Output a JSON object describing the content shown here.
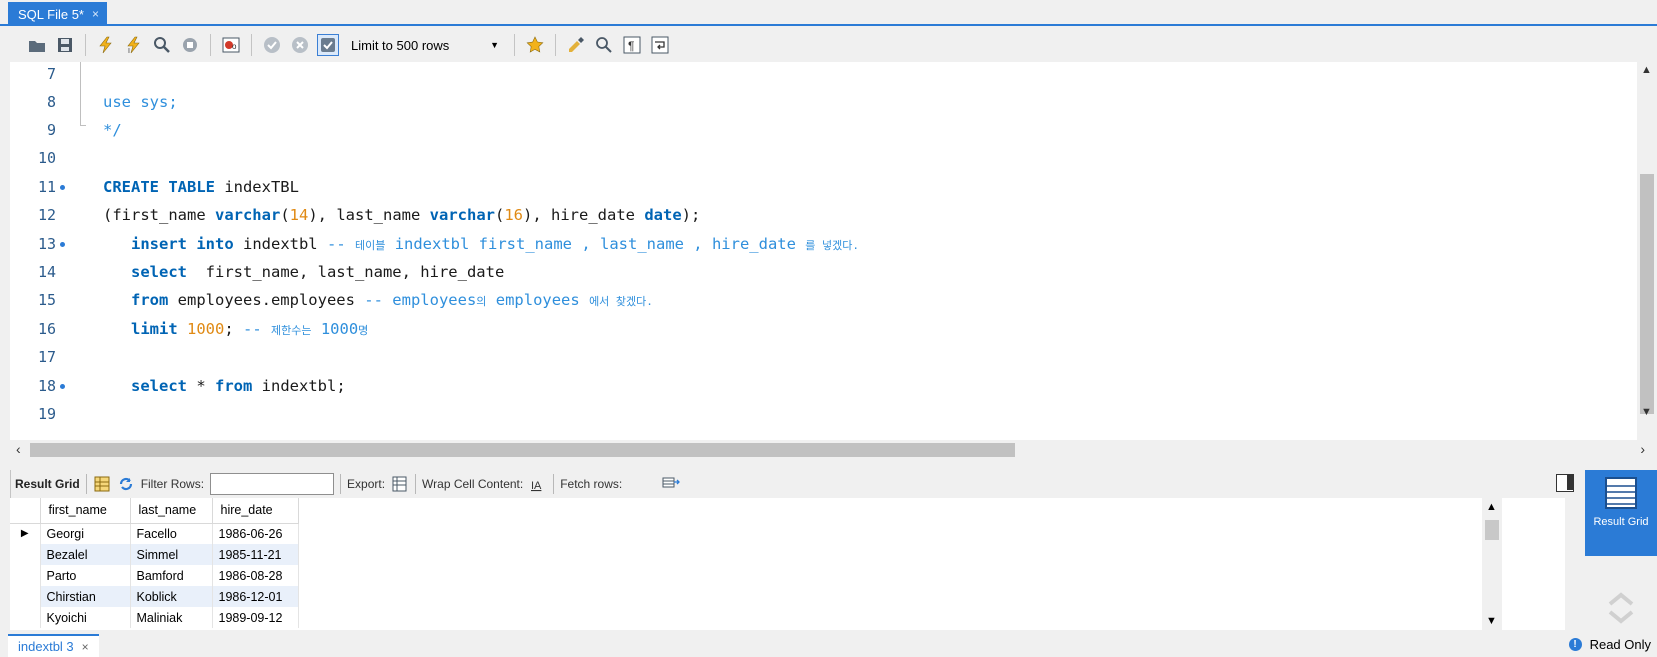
{
  "document_tab": {
    "title": "SQL File 5*",
    "close": "×"
  },
  "toolbar": {
    "limit_select": "Limit to 500 rows",
    "icons": [
      "open-file-icon",
      "save-icon",
      "execute-icon",
      "execute-current-icon",
      "explain-icon",
      "stop-icon",
      "toggle-error-icon",
      "commit-icon",
      "rollback-icon",
      "autocommit-icon",
      "bookmark-icon",
      "beautify-icon",
      "find-icon",
      "invisible-chars-icon",
      "wrap-icon"
    ]
  },
  "editor": {
    "lines": [
      {
        "n": "7"
      },
      {
        "n": "8",
        "t1": "use sys;"
      },
      {
        "n": "9",
        "t1": "*/"
      },
      {
        "n": "10"
      },
      {
        "n": "11",
        "k1": "CREATE TABLE",
        "t1": " indexTBL"
      },
      {
        "n": "12",
        "t1": "(first_name ",
        "k1": "varchar",
        "t2": "(",
        "num1": "14",
        "t3": "), last_name ",
        "k2": "varchar",
        "t4": "(",
        "num2": "16",
        "t5": "), hire_date ",
        "k3": "date",
        "t6": ");"
      },
      {
        "n": "13",
        "k1": "insert into",
        "t1": " indextbl ",
        "c1": "-- ",
        "c2": "테이블",
        "c3": " indextbl first_name , last_name , hire_date ",
        "c4": "를 넣겠다."
      },
      {
        "n": "14",
        "k1": "select",
        "t1": "  first_name, last_name, hire_date"
      },
      {
        "n": "15",
        "k1": "from",
        "t1": " employees.employees ",
        "c1": "-- employees",
        "c2": "의",
        "c3": " employees ",
        "c4": "에서 찾겠다."
      },
      {
        "n": "16",
        "k1": "limit",
        "t1": " ",
        "num1": "1000",
        "t2": "; ",
        "c1": "-- ",
        "c2": "제한수는",
        "c3": " 1000",
        "c4": "명"
      },
      {
        "n": "17"
      },
      {
        "n": "18",
        "k1": "select",
        "t1": " * ",
        "k2": "from",
        "t2": " indextbl;"
      },
      {
        "n": "19"
      }
    ]
  },
  "result_toolbar": {
    "result_grid": "Result Grid",
    "filter_rows": "Filter Rows:",
    "filter_value": "",
    "export": "Export:",
    "wrap": "Wrap Cell Content:",
    "fetch": "Fetch rows:"
  },
  "result_grid": {
    "columns": [
      "first_name",
      "last_name",
      "hire_date"
    ],
    "rows": [
      [
        "Georgi",
        "Facello",
        "1986-06-26"
      ],
      [
        "Bezalel",
        "Simmel",
        "1985-11-21"
      ],
      [
        "Parto",
        "Bamford",
        "1986-08-28"
      ],
      [
        "Chirstian",
        "Koblick",
        "1986-12-01"
      ],
      [
        "Kyoichi",
        "Maliniak",
        "1989-09-12"
      ]
    ]
  },
  "side_panel": {
    "result_grid_label": "Result Grid"
  },
  "bottom_tab": {
    "title": "indextbl 3",
    "close": "×"
  },
  "status": {
    "read_only": "Read Only"
  },
  "colors": {
    "accent": "#2b7bd6",
    "keyword": "#0064b4",
    "comment": "#2f8fdc",
    "number": "#e08a14"
  }
}
